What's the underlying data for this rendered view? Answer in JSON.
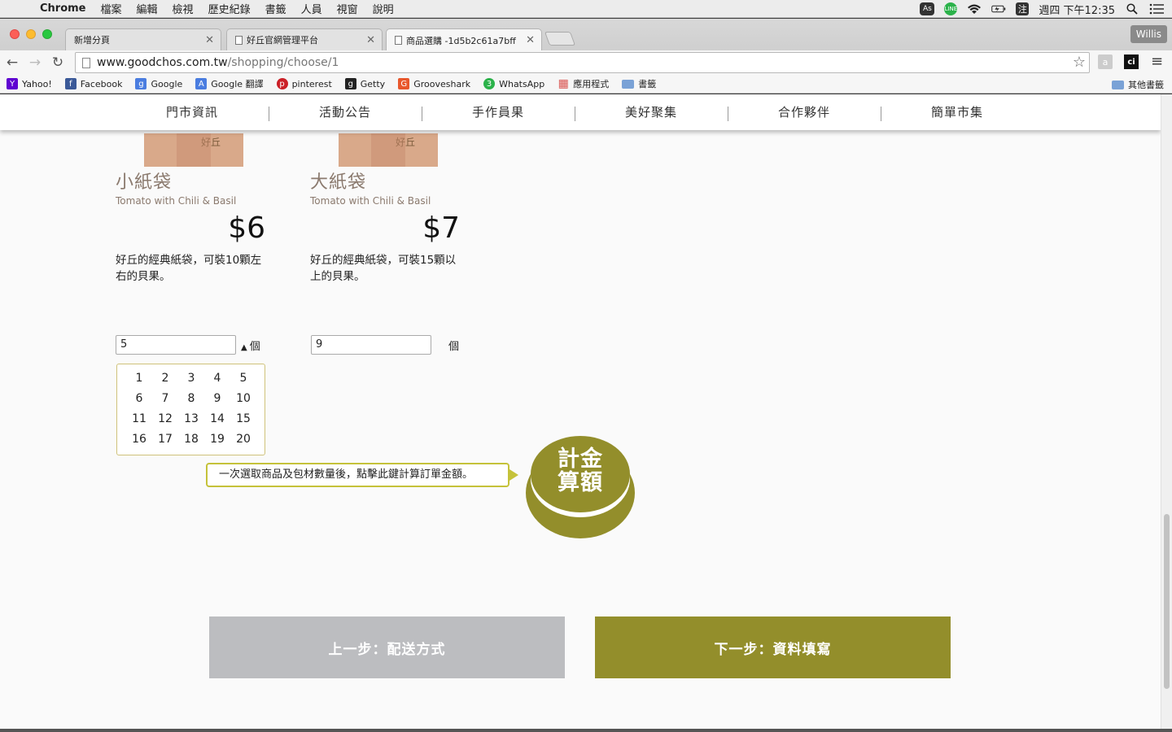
{
  "menubar": {
    "app": "Chrome",
    "items": [
      "檔案",
      "編輯",
      "檢視",
      "歷史紀錄",
      "書籤",
      "人員",
      "視窗",
      "說明"
    ],
    "clock": "週四 下午12:35",
    "as_label": "As",
    "line_label": "LINE",
    "input_label": "注"
  },
  "browser": {
    "tabs": [
      {
        "title": "新增分頁"
      },
      {
        "title": "好丘官網管理平台"
      },
      {
        "title": "商品選購 -1d5b2c61a7bff"
      }
    ],
    "profile": "Willis",
    "url_host": "www.goodchos.com.tw",
    "url_path": "/shopping/choose/1",
    "ext_a": "a",
    "ext_ci": "ci"
  },
  "bookmarks": [
    {
      "label": "Yahoo!",
      "icon": "Y",
      "color": "#5f01d1"
    },
    {
      "label": "Facebook",
      "icon": "f",
      "color": "#3b5998"
    },
    {
      "label": "Google",
      "icon": "g",
      "color": "#4a7de0"
    },
    {
      "label": "Google 翻譯",
      "icon": "A",
      "color": "#4a7de0"
    },
    {
      "label": "pinterest",
      "icon": "p",
      "color": "#cb2027"
    },
    {
      "label": "Getty",
      "icon": "g",
      "color": "#222222"
    },
    {
      "label": "Grooveshark",
      "icon": "G",
      "color": "#e8572c"
    },
    {
      "label": "WhatsApp",
      "icon": "3",
      "color": "#2bb24a"
    },
    {
      "label": "應用程式",
      "icon": "▦",
      "color": "#d9534f"
    },
    {
      "label": "書籤",
      "icon": "",
      "color": "#7aa2d6"
    }
  ],
  "bookmarks_other": "其他書籤",
  "site_nav": [
    "門市資訊",
    "活動公告",
    "手作員果",
    "美好聚集",
    "合作夥伴",
    "簡單市集"
  ],
  "products": [
    {
      "name": "小紙袋",
      "subtitle": "Tomato with Chili & Basil",
      "price": "$6",
      "desc": "好丘的經典紙袋，可裝10顆左右的貝果。",
      "qty": "5",
      "unit": "個",
      "img_mark": "好丘"
    },
    {
      "name": "大紙袋",
      "subtitle": "Tomato with Chili & Basil",
      "price": "$7",
      "desc": "好丘的經典紙袋，可裝15顆以上的貝果。",
      "qty": "9",
      "unit": "個",
      "img_mark": "好丘"
    }
  ],
  "picker": {
    "rows": [
      [
        "1",
        "2",
        "3",
        "4",
        "5"
      ],
      [
        "6",
        "7",
        "8",
        "9",
        "10"
      ],
      [
        "11",
        "12",
        "13",
        "14",
        "15"
      ],
      [
        "16",
        "17",
        "18",
        "19",
        "20"
      ]
    ]
  },
  "tooltip": "一次選取商品及包材數量後，點擊此鍵計算訂單金額。",
  "calc_button": {
    "line1": "計金",
    "line2": "算額"
  },
  "steps": {
    "prev": "上一步：配送方式",
    "next": "下一步：資料填寫"
  },
  "colors": {
    "accent": "#938e2b",
    "muted_button": "#bcbdc0",
    "product_text": "#8b7a6e"
  }
}
